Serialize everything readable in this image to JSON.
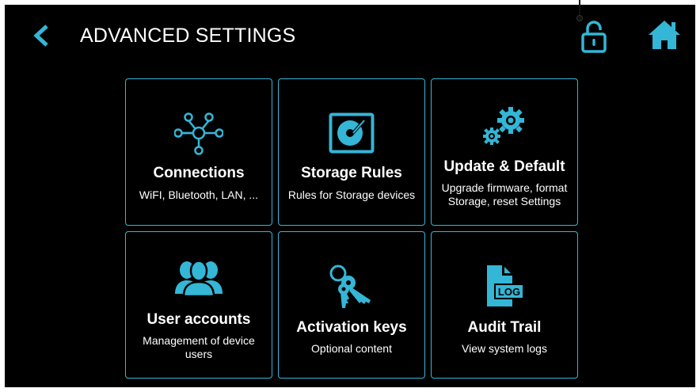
{
  "header": {
    "title": "ADVANCED SETTINGS",
    "back_icon": "chevron-left-icon",
    "lock_icon": "unlock-icon",
    "home_icon": "home-icon"
  },
  "colors": {
    "accent": "#34b6d6",
    "background": "#000000",
    "text": "#ffffff"
  },
  "tiles": [
    {
      "icon": "network-hub-icon",
      "title": "Connections",
      "subtitle": "WiFI, Bluetooth, LAN, ..."
    },
    {
      "icon": "storage-disk-icon",
      "title": "Storage Rules",
      "subtitle": "Rules for Storage devices"
    },
    {
      "icon": "gears-icon",
      "title": "Update & Default",
      "subtitle": "Upgrade firmware, format Storage, reset Settings"
    },
    {
      "icon": "users-icon",
      "title": "User accounts",
      "subtitle": "Management of device users"
    },
    {
      "icon": "keys-icon",
      "title": "Activation keys",
      "subtitle": "Optional content"
    },
    {
      "icon": "log-file-icon",
      "title": "Audit Trail",
      "subtitle": "View system logs"
    }
  ]
}
